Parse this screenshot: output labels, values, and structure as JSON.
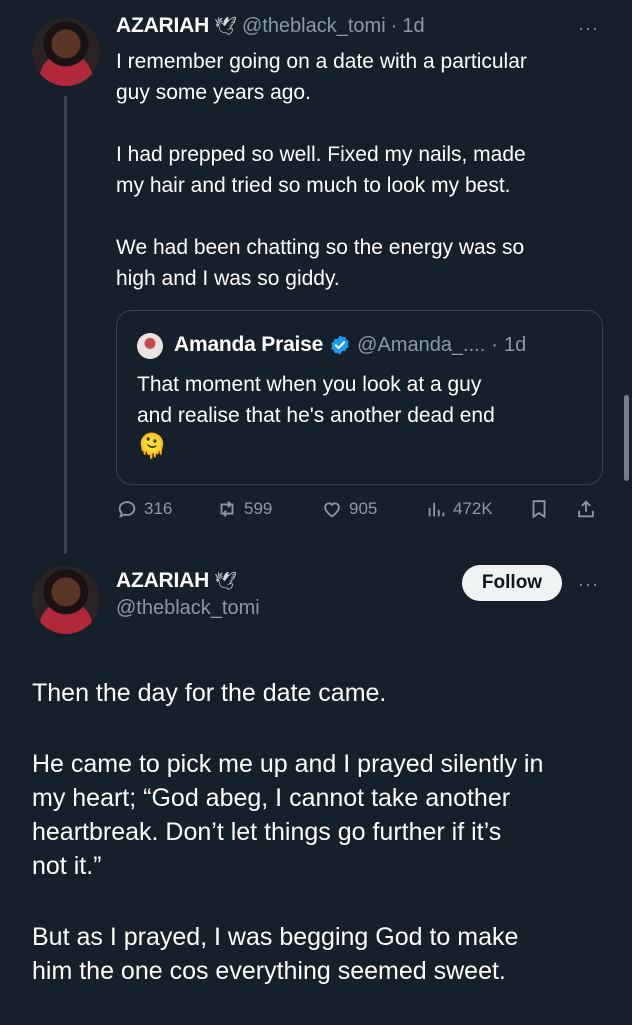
{
  "tweet1": {
    "name": "AZARIAH",
    "name_emoji": "🕊",
    "handle": "@theblack_tomi",
    "sep": "·",
    "time": "1d",
    "more": "···",
    "lines": [
      "I remember going on a date with a particular",
      "guy some years ago.",
      "I had prepped so well. Fixed my nails, made",
      "my hair and tried so much to look my best.",
      "We had been chatting so the energy was so",
      "high and I was so giddy."
    ],
    "quote": {
      "name": "Amanda Praise",
      "handle": "@Amanda_....",
      "sep": "·",
      "time": "1d",
      "lines": [
        "That moment when you look at a guy",
        "and realise that he's another dead end"
      ],
      "emoji": "🫠"
    },
    "actions": {
      "replies": "316",
      "reposts": "599",
      "likes": "905",
      "views": "472K"
    }
  },
  "tweet2": {
    "name": "AZARIAH",
    "name_emoji": "🕊",
    "handle": "@theblack_tomi",
    "follow_label": "Follow",
    "more": "···",
    "paragraphs": [
      "Then the day for the date came.",
      "He came to pick me up and I prayed silently in\nmy heart; “God abeg, I cannot take another\nheartbreak. Don’t let things go further if it’s\nnot it.”",
      "But as I prayed, I was begging God to make\nhim the one cos everything seemed sweet."
    ]
  },
  "colors": {
    "background": "#15202b",
    "muted": "#8b98a5",
    "verified": "#1d9bf0"
  }
}
